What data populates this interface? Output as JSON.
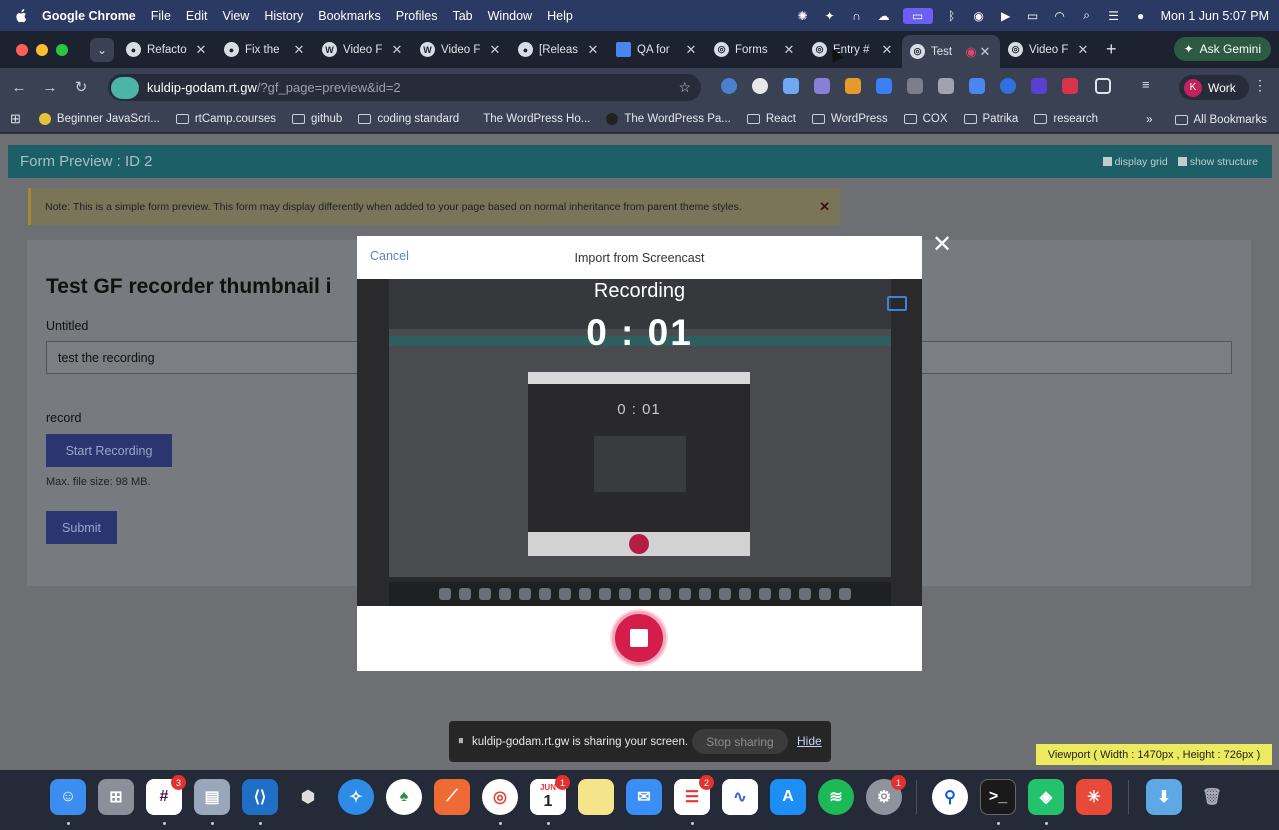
{
  "menubar": {
    "app_name": "Google Chrome",
    "items": [
      "File",
      "Edit",
      "View",
      "History",
      "Bookmarks",
      "Profiles",
      "Tab",
      "Window",
      "Help"
    ],
    "clock": "Mon 1 Jun  5:07 PM"
  },
  "tabs": [
    {
      "label": "Refacto",
      "icon": "github-icon",
      "active": false
    },
    {
      "label": "Fix the",
      "icon": "github-icon",
      "active": false
    },
    {
      "label": "Video F",
      "icon": "wordpress-icon",
      "active": false
    },
    {
      "label": "Video F",
      "icon": "wordpress-icon",
      "active": false
    },
    {
      "label": "[Releas",
      "icon": "github-icon",
      "active": false
    },
    {
      "label": "QA for",
      "icon": "doc-icon",
      "active": false
    },
    {
      "label": "Forms",
      "icon": "globe-icon",
      "active": false
    },
    {
      "label": "Entry #",
      "icon": "globe-icon",
      "active": false
    },
    {
      "label": "Test",
      "icon": "globe-icon",
      "active": true
    },
    {
      "label": "Video F",
      "icon": "globe-icon",
      "active": false
    }
  ],
  "gemini_label": "Ask Gemini",
  "omnibox": {
    "host": "kuldip-godam.rt.gw",
    "path": "/?gf_page=preview&id=2"
  },
  "profile": {
    "initial": "K",
    "label": "Work"
  },
  "bookmarks": [
    {
      "label": "Beginner JavaScri...",
      "type": "site"
    },
    {
      "label": "rtCamp.courses",
      "type": "folder"
    },
    {
      "label": "github",
      "type": "folder"
    },
    {
      "label": "coding standard",
      "type": "folder"
    },
    {
      "label": "The WordPress Ho...",
      "type": "plain"
    },
    {
      "label": "The WordPress Pa...",
      "type": "site"
    },
    {
      "label": "React",
      "type": "folder"
    },
    {
      "label": "WordPress",
      "type": "folder"
    },
    {
      "label": "COX",
      "type": "folder"
    },
    {
      "label": "Patrika",
      "type": "folder"
    },
    {
      "label": "research",
      "type": "folder"
    }
  ],
  "all_bookmarks": "All Bookmarks",
  "page": {
    "header_title": "Form Preview : ID 2",
    "display_grid": "display grid",
    "show_structure": "show structure",
    "note": "Note: This is a simple form preview. This form may display differently when added to your page based on normal inheritance from parent theme styles.",
    "form_title": "Test GF recorder thumbnail i",
    "field_label": "Untitled",
    "field_value": "test the recording",
    "record_label": "record",
    "start_recording": "Start Recording",
    "max_size": "Max. file size: 98 MB.",
    "submit": "Submit"
  },
  "modal": {
    "cancel": "Cancel",
    "title": "Import from Screencast",
    "recording_label": "Recording",
    "timer": "0 : 01",
    "nested_timer": "0 : 01"
  },
  "sharebar": {
    "message": "kuldip-godam.rt.gw is sharing your screen.",
    "stop": "Stop sharing",
    "hide": "Hide"
  },
  "viewport_label": "Viewport ( Width : 1470px , Height : 726px )",
  "dock_badges": {
    "slack": "3",
    "calendar": "1",
    "reminders": "2",
    "settings": "1"
  },
  "calendar": {
    "month": "JUN",
    "day": "1"
  },
  "colors": {
    "accent_stop": "#d41d4a",
    "gf_header": "#1c5f67",
    "button_blue": "#2b3670"
  }
}
